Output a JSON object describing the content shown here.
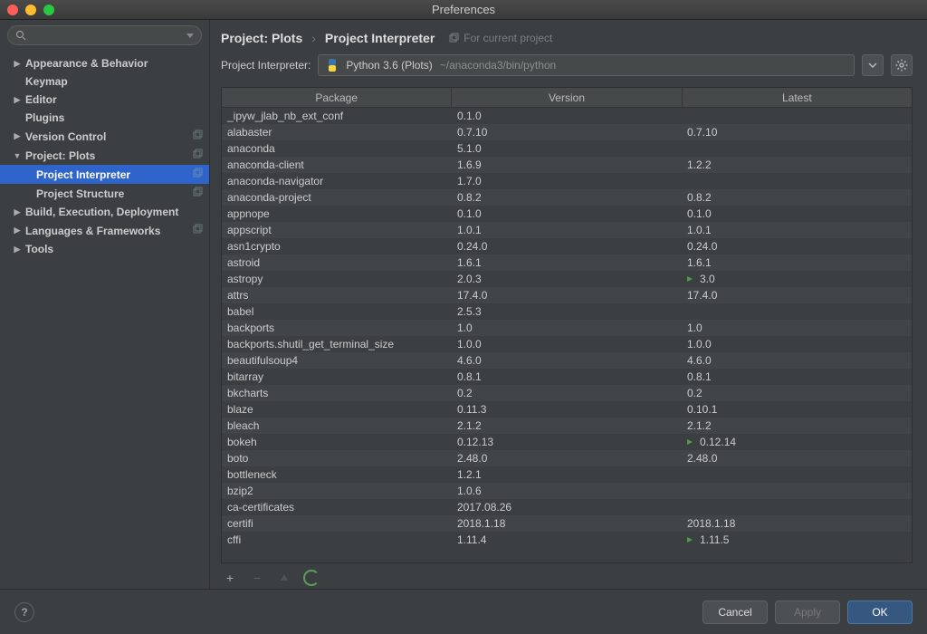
{
  "window": {
    "title": "Preferences"
  },
  "search": {
    "placeholder": "Q"
  },
  "sidebar": [
    {
      "label": "Appearance & Behavior",
      "arrow": "right",
      "indent": 0,
      "copy": false
    },
    {
      "label": "Keymap",
      "arrow": "",
      "indent": 0,
      "copy": false
    },
    {
      "label": "Editor",
      "arrow": "right",
      "indent": 0,
      "copy": false
    },
    {
      "label": "Plugins",
      "arrow": "",
      "indent": 0,
      "copy": false
    },
    {
      "label": "Version Control",
      "arrow": "right",
      "indent": 0,
      "copy": true
    },
    {
      "label": "Project: Plots",
      "arrow": "down",
      "indent": 0,
      "copy": true
    },
    {
      "label": "Project Interpreter",
      "arrow": "",
      "indent": 1,
      "selected": true,
      "copy": true
    },
    {
      "label": "Project Structure",
      "arrow": "",
      "indent": 1,
      "copy": true
    },
    {
      "label": "Build, Execution, Deployment",
      "arrow": "right",
      "indent": 0,
      "copy": false
    },
    {
      "label": "Languages & Frameworks",
      "arrow": "right",
      "indent": 0,
      "copy": true
    },
    {
      "label": "Tools",
      "arrow": "right",
      "indent": 0,
      "copy": false
    }
  ],
  "breadcrumb": {
    "project": "Project: Plots",
    "page": "Project Interpreter",
    "hint": "For current project"
  },
  "interpreter": {
    "label": "Project Interpreter:",
    "name": "Python 3.6 (Plots)",
    "path": "~/anaconda3/bin/python"
  },
  "columns": {
    "package": "Package",
    "version": "Version",
    "latest": "Latest"
  },
  "packages": [
    {
      "name": "_ipyw_jlab_nb_ext_conf",
      "version": "0.1.0",
      "latest": ""
    },
    {
      "name": "alabaster",
      "version": "0.7.10",
      "latest": "0.7.10"
    },
    {
      "name": "anaconda",
      "version": "5.1.0",
      "latest": ""
    },
    {
      "name": "anaconda-client",
      "version": "1.6.9",
      "latest": "1.2.2"
    },
    {
      "name": "anaconda-navigator",
      "version": "1.7.0",
      "latest": ""
    },
    {
      "name": "anaconda-project",
      "version": "0.8.2",
      "latest": "0.8.2"
    },
    {
      "name": "appnope",
      "version": "0.1.0",
      "latest": "0.1.0"
    },
    {
      "name": "appscript",
      "version": "1.0.1",
      "latest": "1.0.1"
    },
    {
      "name": "asn1crypto",
      "version": "0.24.0",
      "latest": "0.24.0"
    },
    {
      "name": "astroid",
      "version": "1.6.1",
      "latest": "1.6.1"
    },
    {
      "name": "astropy",
      "version": "2.0.3",
      "latest": "3.0",
      "upgrade": true
    },
    {
      "name": "attrs",
      "version": "17.4.0",
      "latest": "17.4.0"
    },
    {
      "name": "babel",
      "version": "2.5.3",
      "latest": ""
    },
    {
      "name": "backports",
      "version": "1.0",
      "latest": "1.0"
    },
    {
      "name": "backports.shutil_get_terminal_size",
      "version": "1.0.0",
      "latest": "1.0.0"
    },
    {
      "name": "beautifulsoup4",
      "version": "4.6.0",
      "latest": "4.6.0"
    },
    {
      "name": "bitarray",
      "version": "0.8.1",
      "latest": "0.8.1"
    },
    {
      "name": "bkcharts",
      "version": "0.2",
      "latest": "0.2"
    },
    {
      "name": "blaze",
      "version": "0.11.3",
      "latest": "0.10.1"
    },
    {
      "name": "bleach",
      "version": "2.1.2",
      "latest": "2.1.2"
    },
    {
      "name": "bokeh",
      "version": "0.12.13",
      "latest": "0.12.14",
      "upgrade": true
    },
    {
      "name": "boto",
      "version": "2.48.0",
      "latest": "2.48.0"
    },
    {
      "name": "bottleneck",
      "version": "1.2.1",
      "latest": ""
    },
    {
      "name": "bzip2",
      "version": "1.0.6",
      "latest": ""
    },
    {
      "name": "ca-certificates",
      "version": "2017.08.26",
      "latest": ""
    },
    {
      "name": "certifi",
      "version": "2018.1.18",
      "latest": "2018.1.18"
    },
    {
      "name": "cffi",
      "version": "1.11.4",
      "latest": "1.11.5",
      "upgrade": true
    }
  ],
  "footer": {
    "cancel": "Cancel",
    "apply": "Apply",
    "ok": "OK"
  }
}
